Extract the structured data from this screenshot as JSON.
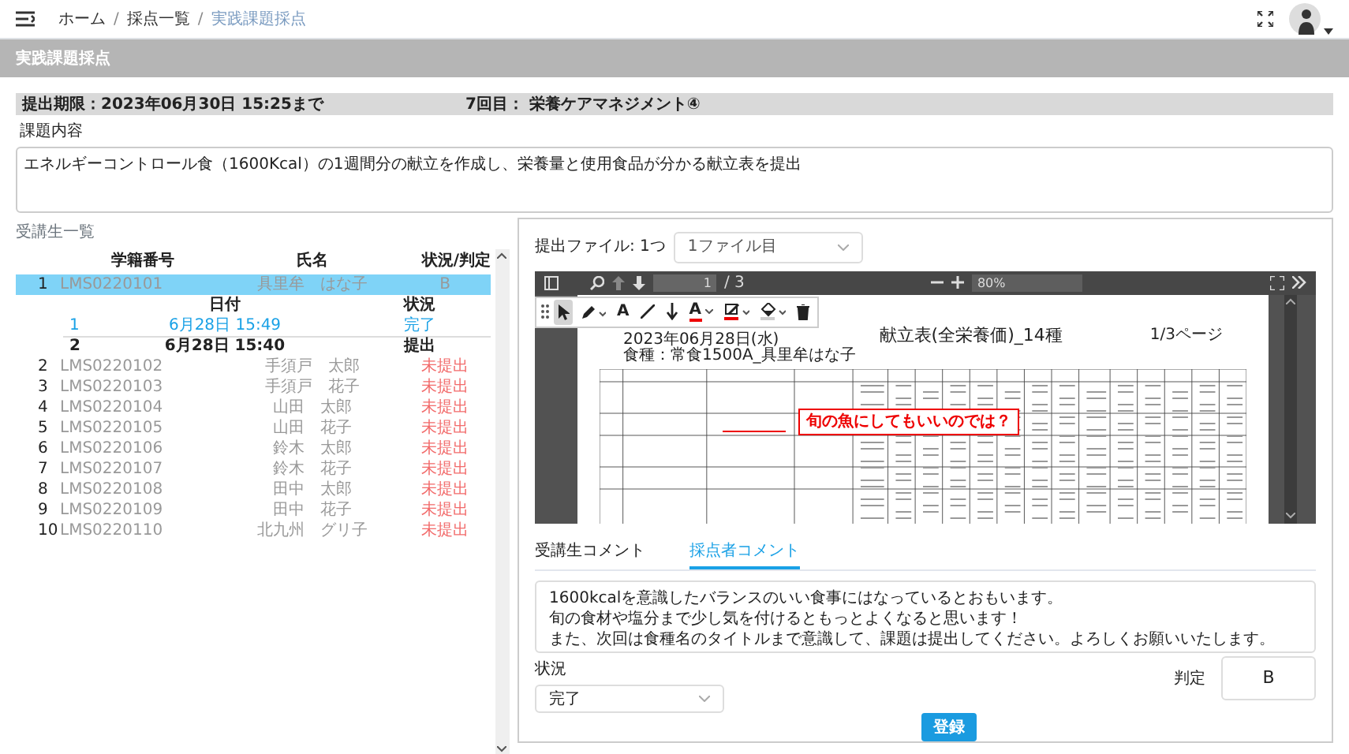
{
  "breadcrumbs": [
    {
      "label": "ホーム",
      "selected": false
    },
    {
      "separator": "/",
      "label": "採点一覧",
      "selected": false
    },
    {
      "separator": "/",
      "label": "実践課題採点",
      "selected": true
    }
  ],
  "page_title": "実践課題採点",
  "assignment": {
    "deadline": "提出期限：2023年06月30日 15:25まで",
    "session": "7回目： 栄養ケアマネジメント④",
    "content_label": "課題内容",
    "content": "エネルギーコントロール食（1600Kcal）の1週間分の献立を作成し、栄養量と使用食品が分かる献立表を提出"
  },
  "students": {
    "title": "受講生一覧",
    "columns": [
      "学籍番号",
      "氏名",
      "状況/判定"
    ],
    "rows": [
      {
        "no": "1",
        "id": "LMS0220101",
        "name": "具里牟　はな子",
        "status": "B",
        "kind": "grade",
        "selected": true,
        "submissions": {
          "columns": [
            "日付",
            "状況"
          ],
          "rows": [
            {
              "no": "1",
              "date": "6月28日 15:49",
              "status": "完了",
              "selected": true
            },
            {
              "no": "2",
              "date": "6月28日 15:40",
              "status": "提出",
              "selected": false
            }
          ]
        }
      },
      {
        "no": "2",
        "id": "LMS0220102",
        "name": "手須戸　太郎",
        "status": "未提出",
        "kind": "missing",
        "selected": false
      },
      {
        "no": "3",
        "id": "LMS0220103",
        "name": "手須戸　花子",
        "status": "未提出",
        "kind": "missing",
        "selected": false
      },
      {
        "no": "4",
        "id": "LMS0220104",
        "name": "山田　太郎",
        "status": "未提出",
        "kind": "missing",
        "selected": false
      },
      {
        "no": "5",
        "id": "LMS0220105",
        "name": "山田　花子",
        "status": "未提出",
        "kind": "missing",
        "selected": false
      },
      {
        "no": "6",
        "id": "LMS0220106",
        "name": "鈴木　太郎",
        "status": "未提出",
        "kind": "missing",
        "selected": false
      },
      {
        "no": "7",
        "id": "LMS0220107",
        "name": "鈴木　花子",
        "status": "未提出",
        "kind": "missing",
        "selected": false
      },
      {
        "no": "8",
        "id": "LMS0220108",
        "name": "田中　太郎",
        "status": "未提出",
        "kind": "missing",
        "selected": false
      },
      {
        "no": "9",
        "id": "LMS0220109",
        "name": "田中　花子",
        "status": "未提出",
        "kind": "missing",
        "selected": false
      },
      {
        "no": "10",
        "id": "LMS0220110",
        "name": "北九州　グリ子",
        "status": "未提出",
        "kind": "missing",
        "selected": false
      }
    ]
  },
  "viewer": {
    "file_label": "提出ファイル: 1つ",
    "file_select": "1ファイル目",
    "page_input": "1",
    "page_total": "/ 3",
    "zoom": "80%",
    "tools": [
      {
        "kind": "select",
        "selected": true
      },
      {
        "kind": "pen",
        "selected": false
      },
      {
        "kind": "text",
        "label": "A",
        "selected": false
      },
      {
        "kind": "line",
        "selected": false
      },
      {
        "kind": "arrow",
        "selected": false
      },
      {
        "kind": "text-color",
        "label": "A",
        "selected": false
      },
      {
        "kind": "highlight",
        "selected": false
      },
      {
        "kind": "fill",
        "selected": false
      },
      {
        "kind": "delete",
        "selected": false
      }
    ],
    "document": {
      "date": "2023年06月28日(水)",
      "meal": "食種：常食1500A_具里牟はな子",
      "title": "献立表(全栄養価)_14種",
      "page_label": "1/3ページ",
      "annotation": "旬の魚にしてもいいのでは？"
    }
  },
  "comment_tabs": [
    {
      "label": "受講生コメント",
      "selected": false
    },
    {
      "label": "採点者コメント",
      "selected": true
    }
  ],
  "comment_lines": [
    "1600kcalを意識したバランスのいい食事にはなっているとおもいます。",
    "旬の食材や塩分まで少し気を付けるともっとよくなると思います！",
    "また、次回は食種名のタイトルまで意識して、課題は提出してください。よろしくお願いいたします。"
  ],
  "status_label": "状況",
  "status_value": "完了",
  "grade_label": "判定",
  "grade_value": "B",
  "submit": "登録"
}
